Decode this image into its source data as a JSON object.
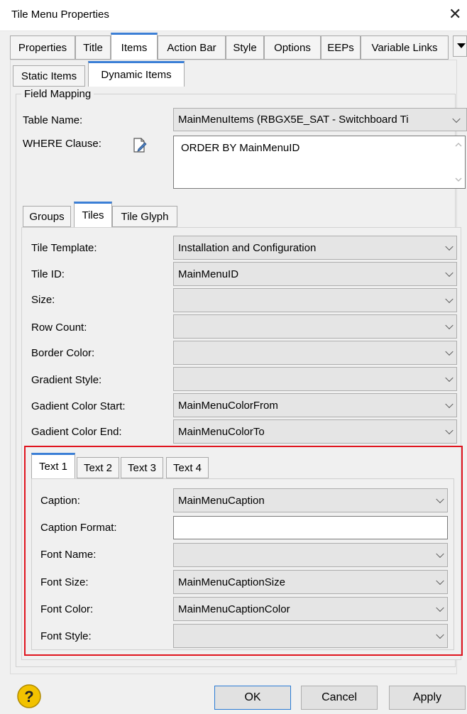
{
  "window": {
    "title": "Tile Menu Properties"
  },
  "top_tabs": [
    "Properties",
    "Title",
    "Items",
    "Action Bar",
    "Style",
    "Options",
    "EEPs",
    "Variable Links"
  ],
  "item_tabs": [
    "Static Items",
    "Dynamic Items"
  ],
  "field_mapping": {
    "heading": "Field Mapping",
    "table_name_label": "Table Name:",
    "table_name_value": "MainMenuItems  (RBGX5E_SAT - Switchboard Ti",
    "where_label": "WHERE Clause:",
    "where_value": "ORDER BY MainMenuID"
  },
  "sub_tabs": [
    "Groups",
    "Tiles",
    "Tile Glyph"
  ],
  "tile_fields": [
    {
      "label": "Tile Template:",
      "value": "Installation and Configuration"
    },
    {
      "label": "Tile ID:",
      "value": "MainMenuID"
    },
    {
      "label": "Size:",
      "value": ""
    },
    {
      "label": "Row Count:",
      "value": ""
    },
    {
      "label": "Border Color:",
      "value": ""
    },
    {
      "label": "Gradient Style:",
      "value": ""
    },
    {
      "label": "Gadient Color Start:",
      "value": "MainMenuColorFrom"
    },
    {
      "label": "Gadient Color End:",
      "value": "MainMenuColorTo"
    }
  ],
  "text_tabs": [
    "Text 1",
    "Text 2",
    "Text 3",
    "Text 4"
  ],
  "text_fields": [
    {
      "label": "Caption:",
      "value": "MainMenuCaption"
    },
    {
      "label": "Caption Format:",
      "value": ""
    },
    {
      "label": "Font Name:",
      "value": ""
    },
    {
      "label": "Font Size:",
      "value": "MainMenuCaptionSize"
    },
    {
      "label": "Font Color:",
      "value": "MainMenuCaptionColor"
    },
    {
      "label": "Font Style:",
      "value": ""
    }
  ],
  "buttons": {
    "help_icon": "?",
    "ok": "OK",
    "cancel": "Cancel",
    "apply": "Apply"
  },
  "colors": {
    "active_tab_accent": "#3b7fd6",
    "highlight_box": "#e0141e",
    "help_icon_fill": "#f2c200"
  }
}
